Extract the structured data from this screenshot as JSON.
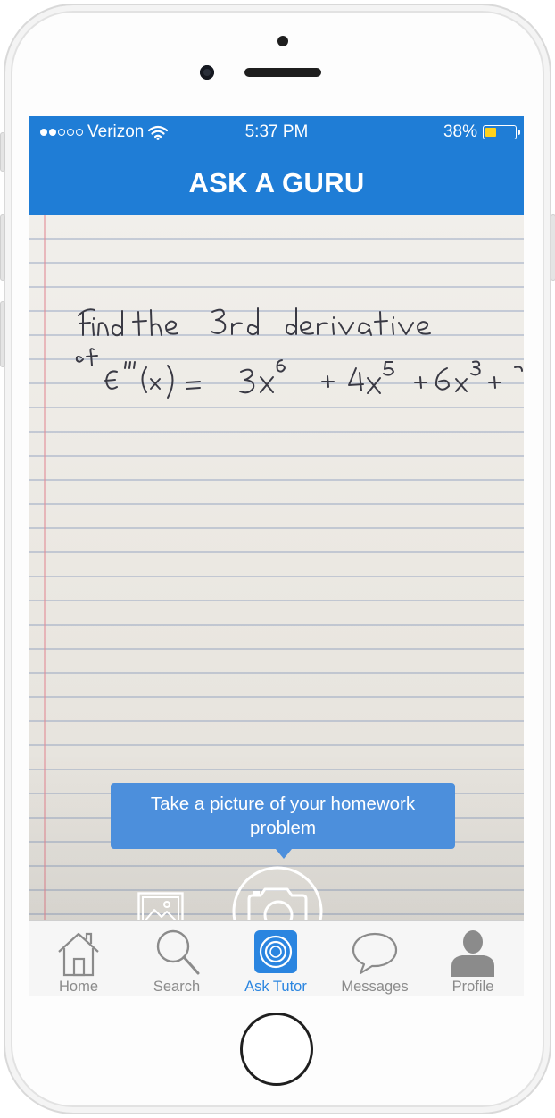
{
  "status_bar": {
    "carrier": "Verizon",
    "signal_dots_filled": 2,
    "signal_dots_total": 5,
    "time": "5:37 PM",
    "battery_percent": "38%",
    "battery_level": 0.38
  },
  "nav": {
    "title": "ASK A GURU"
  },
  "camera_view": {
    "tooltip_text": "Take a picture of your homework problem"
  },
  "tab_bar": {
    "tabs": [
      {
        "label": "Home",
        "icon": "house-icon",
        "active": false
      },
      {
        "label": "Search",
        "icon": "magnifier-icon",
        "active": false
      },
      {
        "label": "Ask Tutor",
        "icon": "camera-lens-icon",
        "active": true
      },
      {
        "label": "Messages",
        "icon": "speech-bubble-icon",
        "active": false
      },
      {
        "label": "Profile",
        "icon": "person-icon",
        "active": false
      }
    ]
  },
  "colors": {
    "brand_blue": "#1f7dd6",
    "tooltip_blue": "#4c8fdc",
    "active_tab": "#2a85e0",
    "inactive_tab": "#8b8b8b",
    "battery_fill": "#ffd21c"
  },
  "icons": {
    "gallery": "image-gallery-icon",
    "shutter": "camera-shutter-icon",
    "wifi": "wifi-icon",
    "battery": "battery-icon"
  }
}
